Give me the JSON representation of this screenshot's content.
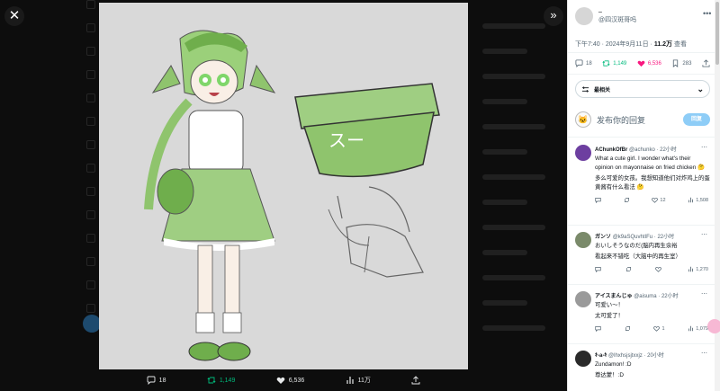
{
  "viewer": {
    "close_icon": "close-icon",
    "expand_icon": "expand-icon",
    "actions": {
      "replies": "18",
      "reposts": "1,149",
      "likes": "6,536",
      "views": "11万"
    },
    "artwork_text": "スー"
  },
  "post": {
    "display_name": "..",
    "handle": "@四汉斑哥吗",
    "time": "下午7:40 · 2024年9月11日 · ",
    "views_count": "11.2万",
    "views_label": " 查看",
    "stats": {
      "replies": "18",
      "reposts": "1,149",
      "likes": "6,536",
      "bookmarks": "283"
    }
  },
  "sort": {
    "label": "最相关"
  },
  "compose": {
    "placeholder": "发布你的回复",
    "button": "回复"
  },
  "replies": [
    {
      "name": "AChunkOfBr",
      "handle": "@achunko · 22小时",
      "lines": [
        "What a cute girl. I wonder what's their opinion on mayonnaise on fried chicken 🤔",
        "多么可爱的女孩。我想知道他们对炸鸡上的蛋黄酱有什么看法 🤔"
      ],
      "likes": "12",
      "views": "1,508",
      "avatar_color": "#6d3fa0"
    },
    {
      "name": "ガンソ",
      "handle": "@k9aSQuvhtIFu · 22小时",
      "lines": [
        "おいしそうなのだ(脳内再生余裕",
        "看起来不错吃（大脑中的再生室）"
      ],
      "likes": "",
      "views": "1,270",
      "avatar_color": "#7a8a6a"
    },
    {
      "name": "アイスまんじゅ",
      "handle": "@aisuma · 22小时",
      "lines": [
        "可爱い〜！",
        "太可爱了！"
      ],
      "likes": "1",
      "views": "1,079",
      "avatar_color": "#9a9a9a"
    },
    {
      "name": "ｷ-a-ｷ",
      "handle": "@lhxhsjsjtxxjz · 20小时",
      "lines": [
        "Zundamon! :D",
        "尊达蒙！:D"
      ],
      "likes": "",
      "views": "",
      "avatar_color": "#2a2a2a"
    }
  ],
  "colors": {
    "green": "#00ba7c",
    "pink": "#f91880",
    "blue": "#1d9bf0"
  }
}
